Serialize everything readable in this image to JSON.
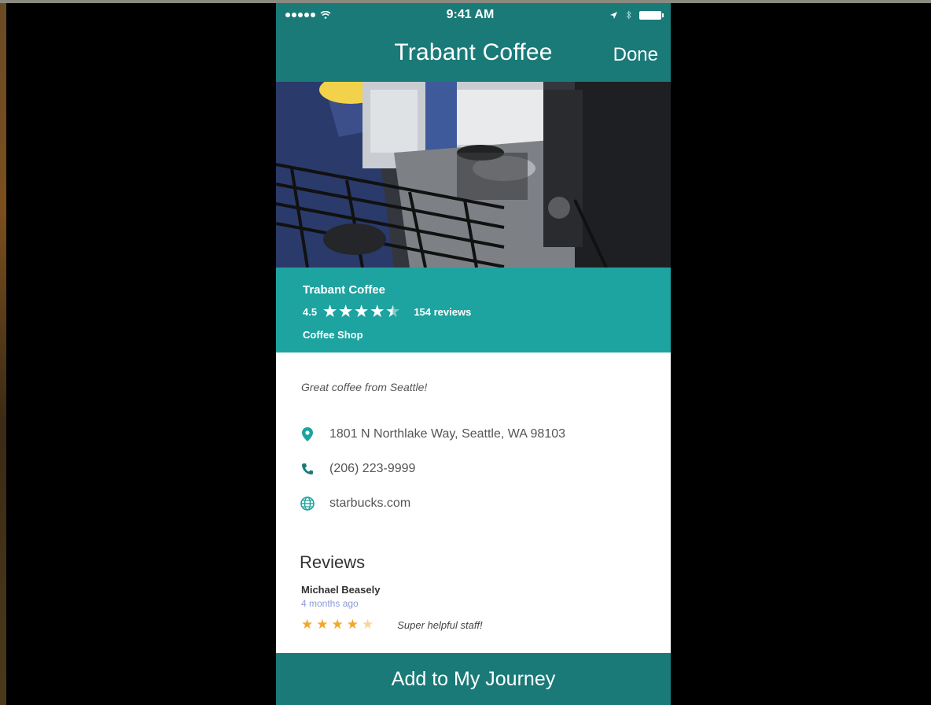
{
  "status_bar": {
    "time": "9:41 AM"
  },
  "nav": {
    "title": "Trabant Coffee",
    "done_label": "Done"
  },
  "place": {
    "name": "Trabant Coffee",
    "rating": "4.5",
    "reviews_count": "154 reviews",
    "category": "Coffee Shop",
    "tagline": "Great coffee from Seattle!",
    "address": "1801 N Northlake Way, Seattle, WA 98103",
    "phone": "(206) 223-9999",
    "website": "starbucks.com"
  },
  "reviews": {
    "heading": "Reviews",
    "items": [
      {
        "author": "Michael Beasely",
        "time": "4 months ago",
        "stars": 4,
        "text": "Super helpful staff!"
      }
    ]
  },
  "cta": {
    "label": "Add to My Journey"
  },
  "colors": {
    "nav": "#1a7a78",
    "band": "#1da3a0",
    "star": "#f2a72a"
  },
  "icons": [
    "wifi-icon",
    "location-arrow-icon",
    "bluetooth-icon",
    "battery-icon",
    "map-pin-icon",
    "phone-icon",
    "globe-icon",
    "star-icon"
  ]
}
